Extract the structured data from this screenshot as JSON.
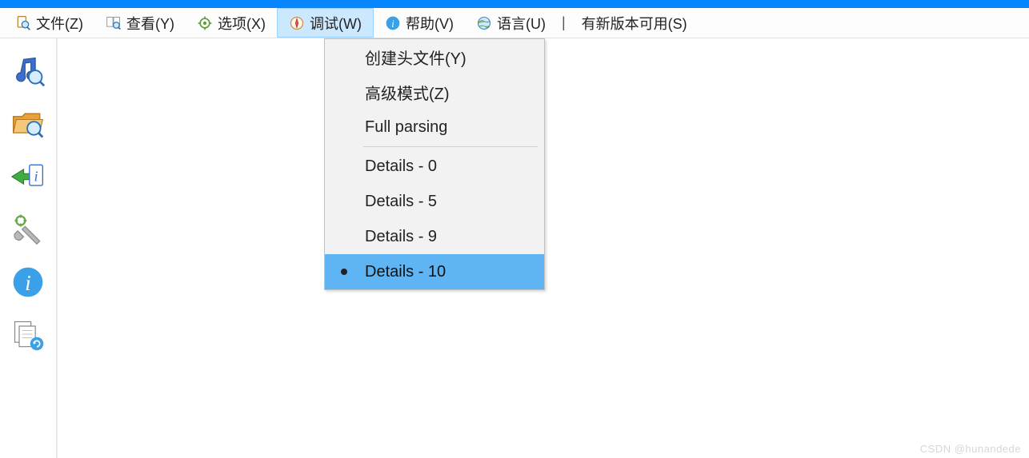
{
  "menubar": {
    "file": "文件(Z)",
    "view": "查看(Y)",
    "options": "选项(X)",
    "debug": "调试(W)",
    "help": "帮助(V)",
    "language": "语言(U)",
    "update": "有新版本可用(S)",
    "separator": "|"
  },
  "dropdown": {
    "create_header": "创建头文件(Y)",
    "advanced_mode": "高级模式(Z)",
    "full_parsing": "Full parsing",
    "details_0": "Details - 0",
    "details_5": "Details - 5",
    "details_9": "Details - 9",
    "details_10": "Details - 10"
  },
  "toolbar": {
    "icons": [
      "music-search-icon",
      "folder-search-icon",
      "import-info-icon",
      "settings-wrench-icon",
      "info-icon",
      "documents-refresh-icon"
    ]
  },
  "watermark": "CSDN @hunandede"
}
